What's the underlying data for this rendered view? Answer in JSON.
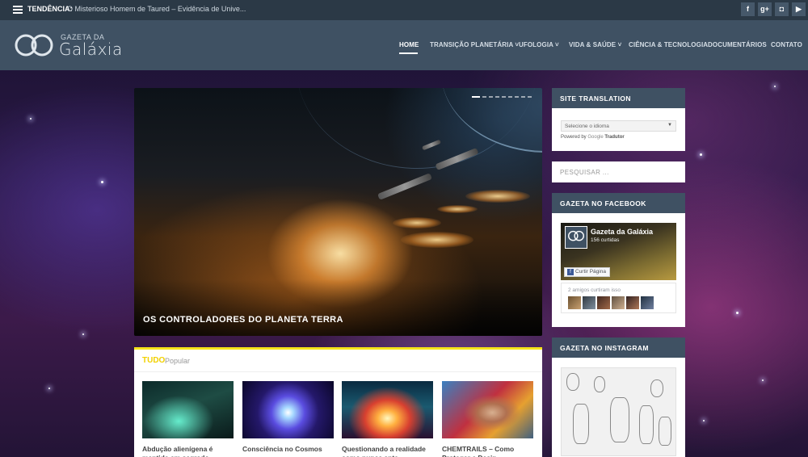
{
  "topbar": {
    "trend_label": "TENDÊNCIA:",
    "trend_text": "O Misterioso Homem de Taured – Evidência de Unive...",
    "social": [
      {
        "name": "facebook",
        "glyph": "f"
      },
      {
        "name": "google-plus",
        "glyph": "g+"
      },
      {
        "name": "instagram",
        "glyph": "◘"
      },
      {
        "name": "youtube",
        "glyph": "▶"
      }
    ]
  },
  "header": {
    "logo_small": "GAZETA DA",
    "logo_big": "Galáxia",
    "nav": [
      {
        "label": "HOME",
        "active": true
      },
      {
        "label": "TRANSIÇÃO PLANETÁRIA ˅"
      },
      {
        "label": "UFOLOGIA ˅"
      },
      {
        "label": "VIDA & SAÚDE ˅"
      },
      {
        "label": "CIÊNCIA & TECNOLOGIA"
      },
      {
        "label": "DOCUMENTÁRIOS"
      },
      {
        "label": "CONTATO"
      }
    ]
  },
  "slider": {
    "title": "OS CONTROLADORES DO PLANETA TERRA",
    "slide_count": 10,
    "active_slide": 1
  },
  "tabs": {
    "active": "TUDO",
    "inactive": "Popular",
    "cards": [
      {
        "title": "Abdução alienígena é mantida em segredo...."
      },
      {
        "title": "Consciência no Cosmos"
      },
      {
        "title": "Questionando a realidade como nunca ante..."
      },
      {
        "title": "CHEMTRAILS – Como Proteger e Desin..."
      }
    ]
  },
  "sidebar": {
    "translation": {
      "title": "SITE TRANSLATION",
      "select_value": "Selecione o idioma",
      "powered_by": "Powered by",
      "google": "Google",
      "tradutor": "Tradutor"
    },
    "search": {
      "placeholder": "PESQUISAR ..."
    },
    "facebook": {
      "title": "GAZETA NO FACEBOOK",
      "page_name": "Gazeta da Galáxia",
      "likes": "156 curtidas",
      "like_button": "Curtir Página",
      "friends_text": "2 amigos curtiram isso"
    },
    "instagram": {
      "title": "GAZETA NO INSTAGRAM"
    }
  }
}
